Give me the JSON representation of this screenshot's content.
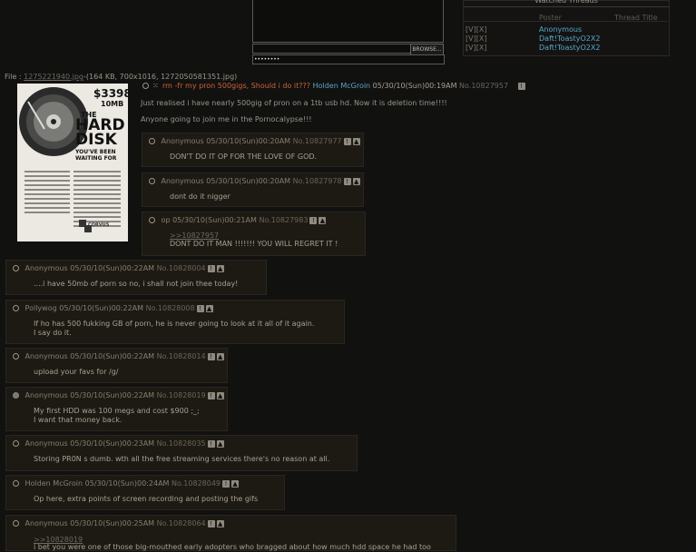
{
  "form": {
    "browse_label": "BROWSE...",
    "password_value": "••••••••"
  },
  "watched": {
    "title": "Watched Threads",
    "col_poster": "Poster",
    "col_title": "Thread Title",
    "rows": [
      {
        "ctl": "[V][X]",
        "poster": "Anonymous"
      },
      {
        "ctl": "[V][X]",
        "poster": "Daft!ToastyO2X2"
      },
      {
        "ctl": "[V][X]",
        "poster": "Daft!ToastyO2X2"
      }
    ]
  },
  "op": {
    "file_label": "File :",
    "file_link": "1275221940.jpg",
    "file_meta": "-(164 KB, 700x1016, 1272050581351.jpg)",
    "subject": "rm -fr my pron 500gigs, Should i do it???",
    "name": "Holden McGroin",
    "date": "05/30/10(Sun)00:19AM",
    "no": "No.10827957",
    "lines": [
      "Just realised i have nearly 500gig of pron on a 1tb usb hd. Now it is deletion time!!!!",
      "Anyone going to join me in the Pornocalypse!!!"
    ],
    "ad": {
      "price": "$3398",
      "size": "10MB",
      "the": "THE",
      "hard": "HARD",
      "disk": "DISK",
      "tag1": "YOU'VE BEEN",
      "tag2": "WAITING FOR",
      "brand": "CORVUS"
    }
  },
  "replies": [
    {
      "name": "Anonymous",
      "date": "05/30/10(Sun)00:20AM",
      "no": "No.10827977",
      "quote": "",
      "body": "DON'T DO IT OP FOR THE LOVE OF GOD."
    },
    {
      "name": "Anonymous",
      "date": "05/30/10(Sun)00:20AM",
      "no": "No.10827978",
      "quote": "",
      "body": "dont do it nigger"
    },
    {
      "name": "op",
      "date": "05/30/10(Sun)00:21AM",
      "no": "No.10827983",
      "quote": ">>10827957",
      "body": "DONT DO IT MAN !!!!!!! YOU WILL REGRET IT !"
    },
    {
      "name": "Anonymous",
      "date": "05/30/10(Sun)00:22AM",
      "no": "No.10828004",
      "quote": "",
      "body": "....i have 50mb of porn so no, i shall not join thee today!"
    },
    {
      "name": "Pollywog",
      "date": "05/30/10(Sun)00:22AM",
      "no": "No.10828008",
      "quote": "",
      "body": "If ho has 500 fukking GB of porn, he is never going to look at it all of it again.\nI say do it."
    },
    {
      "name": "Anonymous",
      "date": "05/30/10(Sun)00:22AM",
      "no": "No.10828014",
      "quote": "",
      "body": "upload your favs for /g/"
    },
    {
      "name": "Anonymous",
      "date": "05/30/10(Sun)00:22AM",
      "no": "No.10828019",
      "quote": "",
      "body": "My first HDD was 100 megs and cost $900 ;_;\nI want that money back."
    },
    {
      "name": "Anonymous",
      "date": "05/30/10(Sun)00:23AM",
      "no": "No.10828035",
      "quote": "",
      "body": "Storing PR0N s dumb. wth all the free streaming services there's no reason at all."
    },
    {
      "name": "Holden McGroin",
      "date": "05/30/10(Sun)00:24AM",
      "no": "No.10828049",
      "quote": "",
      "body": "Op here, extra points of screen recording and posting the gifs"
    },
    {
      "name": "Anonymous",
      "date": "05/30/10(Sun)00:25AM",
      "no": "No.10828064",
      "quote": ">>10828019",
      "body": "i bet you were one of those big-mouthed early adopters who bragged about how much hdd space he had too"
    }
  ]
}
